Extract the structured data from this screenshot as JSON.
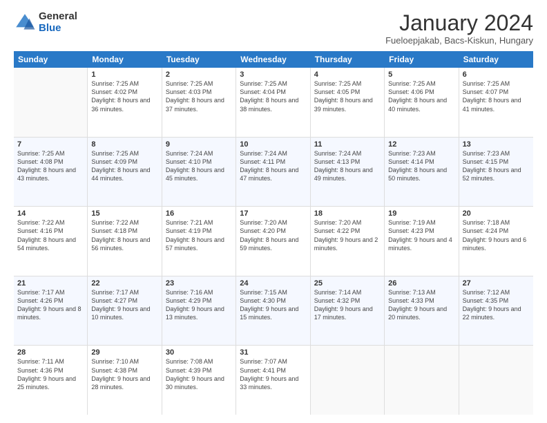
{
  "logo": {
    "general": "General",
    "blue": "Blue"
  },
  "title": "January 2024",
  "location": "Fueloepjakab, Bacs-Kiskun, Hungary",
  "days_header": [
    "Sunday",
    "Monday",
    "Tuesday",
    "Wednesday",
    "Thursday",
    "Friday",
    "Saturday"
  ],
  "weeks": [
    [
      {
        "day": null,
        "sunrise": null,
        "sunset": null,
        "daylight": null
      },
      {
        "day": "1",
        "sunrise": "Sunrise: 7:25 AM",
        "sunset": "Sunset: 4:02 PM",
        "daylight": "Daylight: 8 hours and 36 minutes."
      },
      {
        "day": "2",
        "sunrise": "Sunrise: 7:25 AM",
        "sunset": "Sunset: 4:03 PM",
        "daylight": "Daylight: 8 hours and 37 minutes."
      },
      {
        "day": "3",
        "sunrise": "Sunrise: 7:25 AM",
        "sunset": "Sunset: 4:04 PM",
        "daylight": "Daylight: 8 hours and 38 minutes."
      },
      {
        "day": "4",
        "sunrise": "Sunrise: 7:25 AM",
        "sunset": "Sunset: 4:05 PM",
        "daylight": "Daylight: 8 hours and 39 minutes."
      },
      {
        "day": "5",
        "sunrise": "Sunrise: 7:25 AM",
        "sunset": "Sunset: 4:06 PM",
        "daylight": "Daylight: 8 hours and 40 minutes."
      },
      {
        "day": "6",
        "sunrise": "Sunrise: 7:25 AM",
        "sunset": "Sunset: 4:07 PM",
        "daylight": "Daylight: 8 hours and 41 minutes."
      }
    ],
    [
      {
        "day": "7",
        "sunrise": "Sunrise: 7:25 AM",
        "sunset": "Sunset: 4:08 PM",
        "daylight": "Daylight: 8 hours and 43 minutes."
      },
      {
        "day": "8",
        "sunrise": "Sunrise: 7:25 AM",
        "sunset": "Sunset: 4:09 PM",
        "daylight": "Daylight: 8 hours and 44 minutes."
      },
      {
        "day": "9",
        "sunrise": "Sunrise: 7:24 AM",
        "sunset": "Sunset: 4:10 PM",
        "daylight": "Daylight: 8 hours and 45 minutes."
      },
      {
        "day": "10",
        "sunrise": "Sunrise: 7:24 AM",
        "sunset": "Sunset: 4:11 PM",
        "daylight": "Daylight: 8 hours and 47 minutes."
      },
      {
        "day": "11",
        "sunrise": "Sunrise: 7:24 AM",
        "sunset": "Sunset: 4:13 PM",
        "daylight": "Daylight: 8 hours and 49 minutes."
      },
      {
        "day": "12",
        "sunrise": "Sunrise: 7:23 AM",
        "sunset": "Sunset: 4:14 PM",
        "daylight": "Daylight: 8 hours and 50 minutes."
      },
      {
        "day": "13",
        "sunrise": "Sunrise: 7:23 AM",
        "sunset": "Sunset: 4:15 PM",
        "daylight": "Daylight: 8 hours and 52 minutes."
      }
    ],
    [
      {
        "day": "14",
        "sunrise": "Sunrise: 7:22 AM",
        "sunset": "Sunset: 4:16 PM",
        "daylight": "Daylight: 8 hours and 54 minutes."
      },
      {
        "day": "15",
        "sunrise": "Sunrise: 7:22 AM",
        "sunset": "Sunset: 4:18 PM",
        "daylight": "Daylight: 8 hours and 56 minutes."
      },
      {
        "day": "16",
        "sunrise": "Sunrise: 7:21 AM",
        "sunset": "Sunset: 4:19 PM",
        "daylight": "Daylight: 8 hours and 57 minutes."
      },
      {
        "day": "17",
        "sunrise": "Sunrise: 7:20 AM",
        "sunset": "Sunset: 4:20 PM",
        "daylight": "Daylight: 8 hours and 59 minutes."
      },
      {
        "day": "18",
        "sunrise": "Sunrise: 7:20 AM",
        "sunset": "Sunset: 4:22 PM",
        "daylight": "Daylight: 9 hours and 2 minutes."
      },
      {
        "day": "19",
        "sunrise": "Sunrise: 7:19 AM",
        "sunset": "Sunset: 4:23 PM",
        "daylight": "Daylight: 9 hours and 4 minutes."
      },
      {
        "day": "20",
        "sunrise": "Sunrise: 7:18 AM",
        "sunset": "Sunset: 4:24 PM",
        "daylight": "Daylight: 9 hours and 6 minutes."
      }
    ],
    [
      {
        "day": "21",
        "sunrise": "Sunrise: 7:17 AM",
        "sunset": "Sunset: 4:26 PM",
        "daylight": "Daylight: 9 hours and 8 minutes."
      },
      {
        "day": "22",
        "sunrise": "Sunrise: 7:17 AM",
        "sunset": "Sunset: 4:27 PM",
        "daylight": "Daylight: 9 hours and 10 minutes."
      },
      {
        "day": "23",
        "sunrise": "Sunrise: 7:16 AM",
        "sunset": "Sunset: 4:29 PM",
        "daylight": "Daylight: 9 hours and 13 minutes."
      },
      {
        "day": "24",
        "sunrise": "Sunrise: 7:15 AM",
        "sunset": "Sunset: 4:30 PM",
        "daylight": "Daylight: 9 hours and 15 minutes."
      },
      {
        "day": "25",
        "sunrise": "Sunrise: 7:14 AM",
        "sunset": "Sunset: 4:32 PM",
        "daylight": "Daylight: 9 hours and 17 minutes."
      },
      {
        "day": "26",
        "sunrise": "Sunrise: 7:13 AM",
        "sunset": "Sunset: 4:33 PM",
        "daylight": "Daylight: 9 hours and 20 minutes."
      },
      {
        "day": "27",
        "sunrise": "Sunrise: 7:12 AM",
        "sunset": "Sunset: 4:35 PM",
        "daylight": "Daylight: 9 hours and 22 minutes."
      }
    ],
    [
      {
        "day": "28",
        "sunrise": "Sunrise: 7:11 AM",
        "sunset": "Sunset: 4:36 PM",
        "daylight": "Daylight: 9 hours and 25 minutes."
      },
      {
        "day": "29",
        "sunrise": "Sunrise: 7:10 AM",
        "sunset": "Sunset: 4:38 PM",
        "daylight": "Daylight: 9 hours and 28 minutes."
      },
      {
        "day": "30",
        "sunrise": "Sunrise: 7:08 AM",
        "sunset": "Sunset: 4:39 PM",
        "daylight": "Daylight: 9 hours and 30 minutes."
      },
      {
        "day": "31",
        "sunrise": "Sunrise: 7:07 AM",
        "sunset": "Sunset: 4:41 PM",
        "daylight": "Daylight: 9 hours and 33 minutes."
      },
      {
        "day": null,
        "sunrise": null,
        "sunset": null,
        "daylight": null
      },
      {
        "day": null,
        "sunrise": null,
        "sunset": null,
        "daylight": null
      },
      {
        "day": null,
        "sunrise": null,
        "sunset": null,
        "daylight": null
      }
    ]
  ]
}
